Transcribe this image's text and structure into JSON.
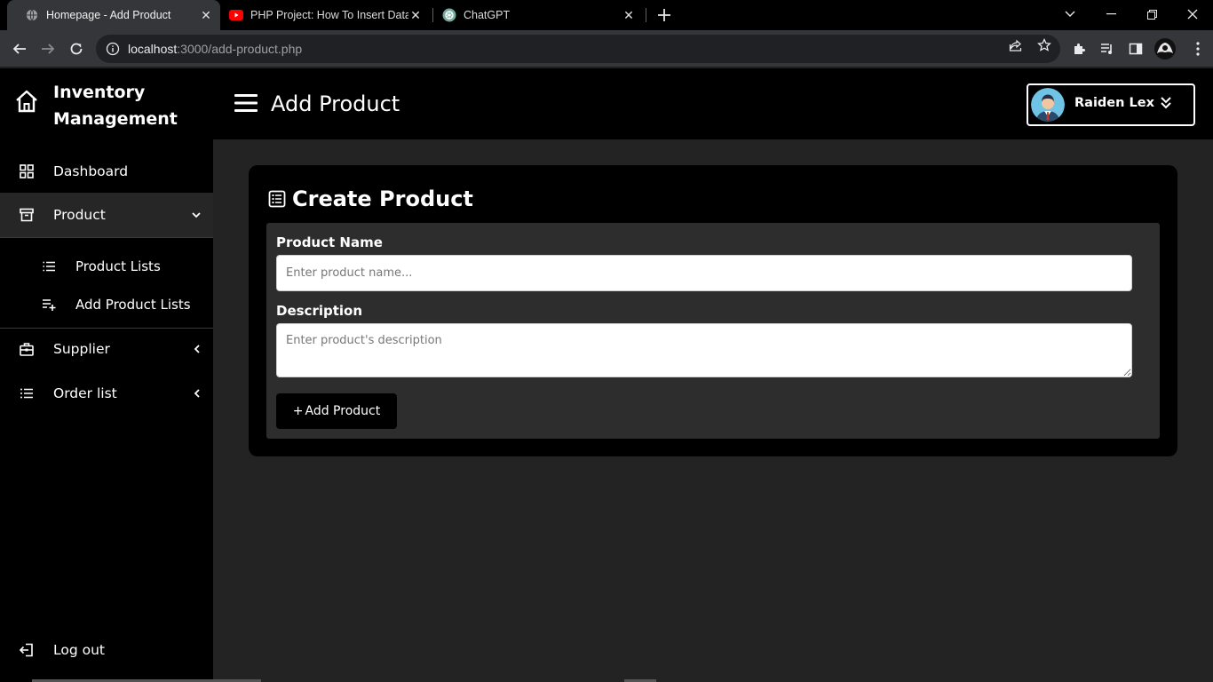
{
  "browser": {
    "tabs": [
      {
        "title": "Homepage - Add Product",
        "favicon": "globe-icon"
      },
      {
        "title": "PHP Project: How To Insert Data I",
        "favicon": "youtube-icon"
      },
      {
        "title": "ChatGPT",
        "favicon": "chatgpt-icon"
      }
    ],
    "url_host": "localhost",
    "url_rest": ":3000/add-product.php"
  },
  "app": {
    "brand": "Inventory Management",
    "page_title": "Add Product",
    "user": {
      "name": "Raiden Lex"
    }
  },
  "sidebar": {
    "items": [
      {
        "label": "Dashboard",
        "icon": "grid-icon"
      },
      {
        "label": "Product",
        "icon": "archive-icon",
        "expanded": true
      },
      {
        "label": "Supplier",
        "icon": "briefcase-icon"
      },
      {
        "label": "Order list",
        "icon": "list-icon"
      }
    ],
    "subitems": [
      {
        "label": "Product Lists",
        "icon": "list-ordered-icon"
      },
      {
        "label": "Add Product Lists",
        "icon": "playlist-add-icon"
      }
    ],
    "logout": "Log out"
  },
  "form": {
    "title": "Create Product",
    "name_label": "Product Name",
    "name_placeholder": "Enter product name...",
    "desc_label": "Description",
    "desc_placeholder": "Enter product's description",
    "submit_label": "Add Product",
    "submit_prefix": "+"
  },
  "colors": {
    "sidebar_bg": "#000000",
    "content_bg": "#232323",
    "card_bg": "#000000",
    "form_bg": "#2d2d2d",
    "active_nav_bg": "#262626"
  }
}
